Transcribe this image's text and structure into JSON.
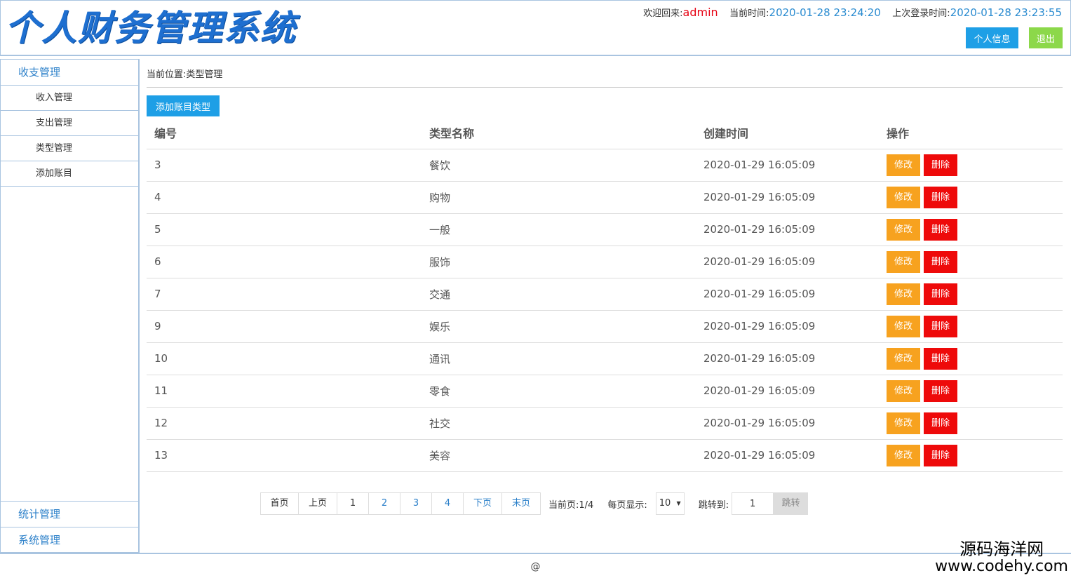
{
  "header": {
    "logo": "个人财务管理系统",
    "welcome_label": "欢迎回来:",
    "username": "admin",
    "current_time_label": "当前时间:",
    "current_time": "2020-01-28 23:24:20",
    "last_login_label": "上次登录时间:",
    "last_login": "2020-01-28 23:23:55",
    "profile_button": "个人信息",
    "logout_button": "退出"
  },
  "sidebar": {
    "group_top": "收支管理",
    "items": [
      {
        "label": "收入管理"
      },
      {
        "label": "支出管理"
      },
      {
        "label": "类型管理"
      },
      {
        "label": "添加账目"
      }
    ],
    "group_stats": "统计管理",
    "group_system": "系统管理"
  },
  "main": {
    "breadcrumb": "当前位置:类型管理",
    "add_button": "添加账目类型",
    "columns": [
      "编号",
      "类型名称",
      "创建时间",
      "操作"
    ],
    "edit_label": "修改",
    "delete_label": "删除",
    "rows": [
      {
        "id": "3",
        "name": "餐饮",
        "created": "2020-01-29 16:05:09"
      },
      {
        "id": "4",
        "name": "购物",
        "created": "2020-01-29 16:05:09"
      },
      {
        "id": "5",
        "name": "一般",
        "created": "2020-01-29 16:05:09"
      },
      {
        "id": "6",
        "name": "服饰",
        "created": "2020-01-29 16:05:09"
      },
      {
        "id": "7",
        "name": "交通",
        "created": "2020-01-29 16:05:09"
      },
      {
        "id": "9",
        "name": "娱乐",
        "created": "2020-01-29 16:05:09"
      },
      {
        "id": "10",
        "name": "通讯",
        "created": "2020-01-29 16:05:09"
      },
      {
        "id": "11",
        "name": "零食",
        "created": "2020-01-29 16:05:09"
      },
      {
        "id": "12",
        "name": "社交",
        "created": "2020-01-29 16:05:09"
      },
      {
        "id": "13",
        "name": "美容",
        "created": "2020-01-29 16:05:09"
      }
    ]
  },
  "pagination": {
    "first": "首页",
    "prev": "上页",
    "pages": [
      "1",
      "2",
      "3",
      "4"
    ],
    "next": "下页",
    "last": "末页",
    "current_page_label": "当前页:1/4",
    "page_size_label": "每页显示:",
    "page_size": "10",
    "jump_label": "跳转到:",
    "jump_value": "1",
    "jump_button": "跳转"
  },
  "footer": {
    "text": "@"
  },
  "watermark": {
    "line1": "源码海洋网",
    "line2": "www.codehy.com"
  },
  "colors": {
    "accent_blue": "#1e9fe6",
    "logout_green": "#8cd84a",
    "edit_orange": "#f7a21f",
    "delete_red": "#ee0a0a",
    "border_blue": "#a9c4e0"
  }
}
